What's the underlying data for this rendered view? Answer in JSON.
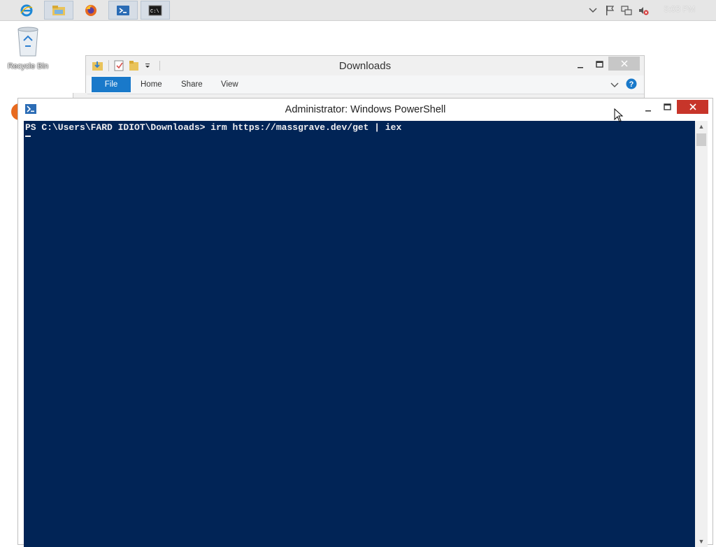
{
  "taskbar": {
    "apps": [
      {
        "name": "internet-explorer-icon"
      },
      {
        "name": "file-explorer-icon"
      },
      {
        "name": "firefox-icon"
      },
      {
        "name": "powershell-icon"
      },
      {
        "name": "command-prompt-icon"
      }
    ],
    "clock": "5:03 PM"
  },
  "desktop": {
    "recycle_bin_label": "Recycle Bin"
  },
  "explorer": {
    "title": "Downloads",
    "tabs": [
      "File",
      "Home",
      "Share",
      "View"
    ]
  },
  "powershell": {
    "title": "Administrator: Windows PowerShell",
    "prompt_line": "PS C:\\Users\\FARD IDIOT\\Downloads> irm https://massgrave.dev/get | iex"
  },
  "colors": {
    "console_bg": "#012456",
    "ribbon_file_tab": "#1979ca",
    "close_button": "#c7352a"
  }
}
